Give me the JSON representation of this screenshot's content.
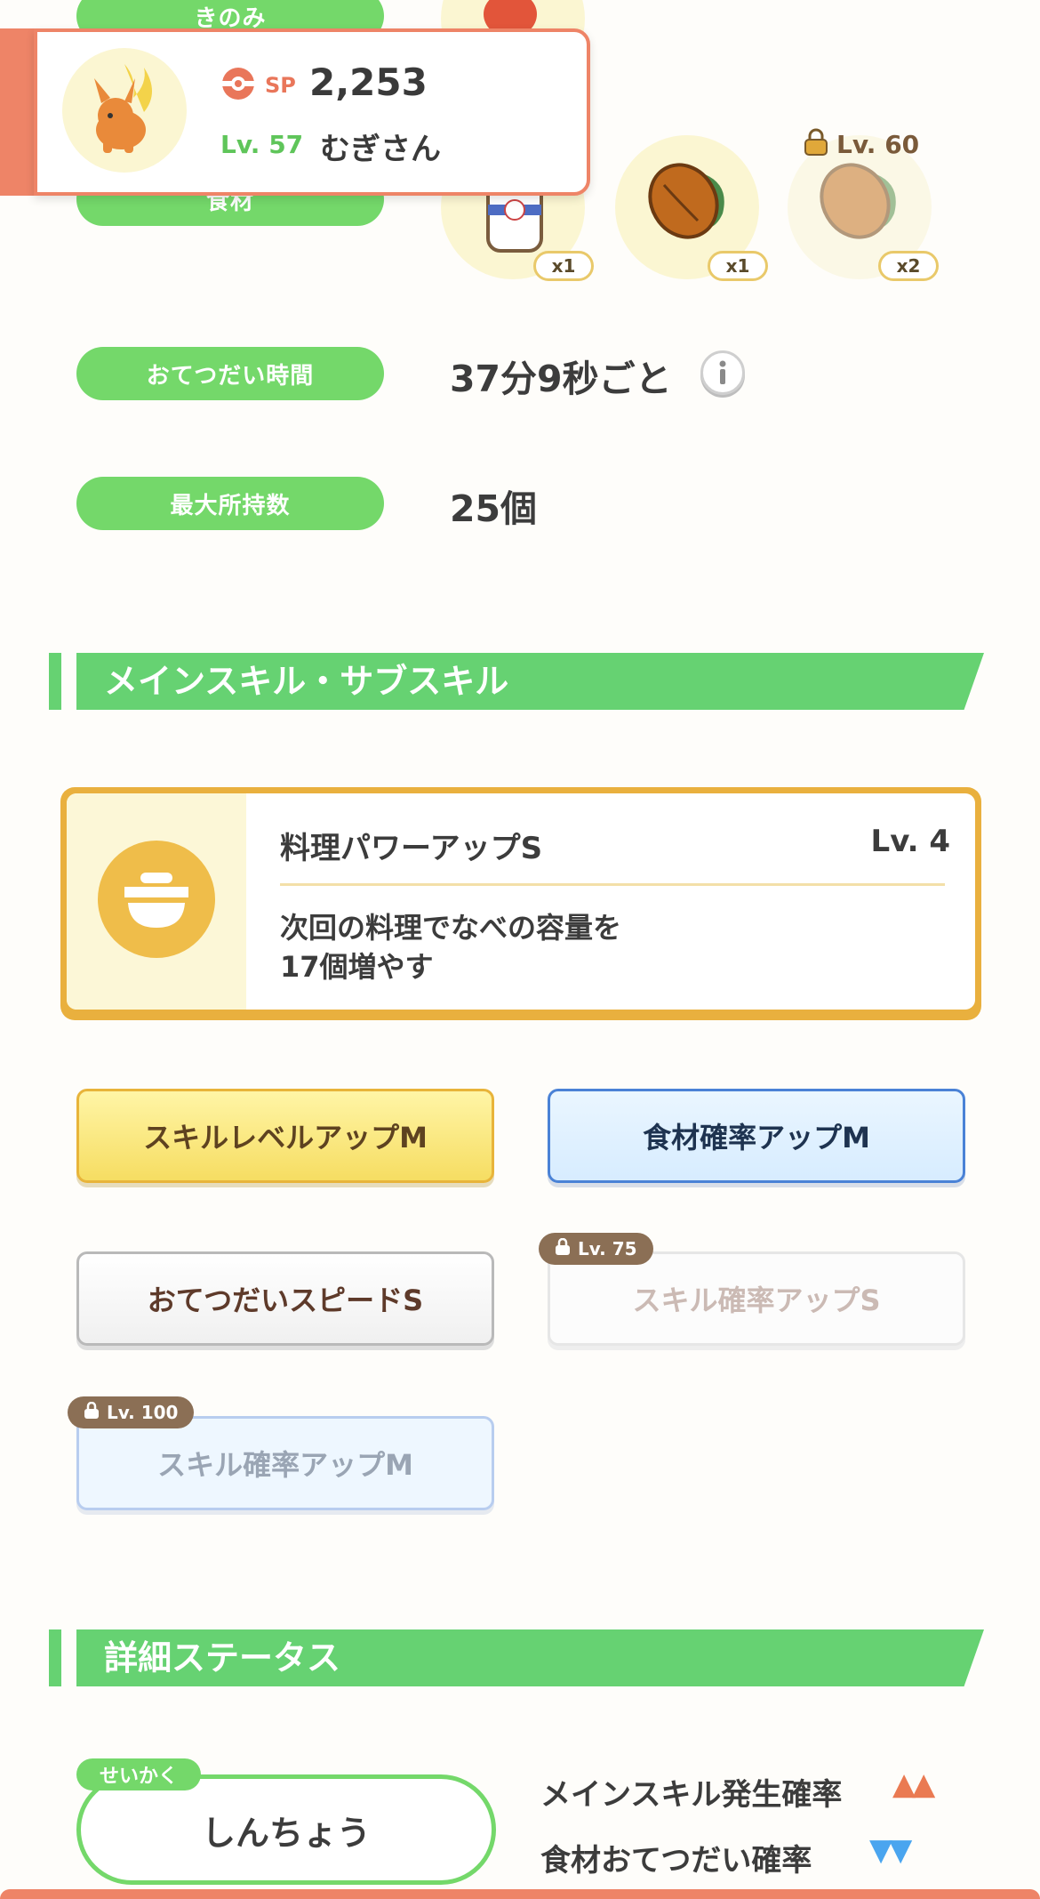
{
  "labels": {
    "berry": "きのみ",
    "ingredient": "食材",
    "help_time": "おてつだい時間",
    "max_carry": "最大所持数"
  },
  "values": {
    "help_time": "37分9秒ごと",
    "max_carry": "25個"
  },
  "ingredients": [
    {
      "name": "milk-icon",
      "qty": "x1",
      "locked": false
    },
    {
      "name": "cacao-icon",
      "qty": "x1",
      "locked": false
    },
    {
      "name": "cacao-icon",
      "qty": "x2",
      "locked": true,
      "unlock_level": "Lv. 60"
    }
  ],
  "profile": {
    "sp_label": "SP",
    "sp_value": "2,253",
    "level": "Lv. 57",
    "name": "むぎさん"
  },
  "sections": {
    "skills": "メインスキル・サブスキル",
    "details": "詳細ステータス"
  },
  "main_skill": {
    "name": "料理パワーアップS",
    "level": "Lv. 4",
    "desc_line1": "次回の料理でなべの容量を",
    "desc_line2": "17個増やす"
  },
  "subskills": [
    {
      "label": "スキルレベルアップM",
      "style": "gold",
      "locked": false
    },
    {
      "label": "食材確率アップM",
      "style": "blue",
      "locked": false
    },
    {
      "label": "おてつだいスピードS",
      "style": "white",
      "locked": false
    },
    {
      "label": "スキル確率アップS",
      "style": "white",
      "locked": true,
      "unlock_level": "Lv. 75"
    },
    {
      "label": "スキル確率アップM",
      "style": "blue",
      "locked": true,
      "unlock_level": "Lv. 100"
    }
  ],
  "nature": {
    "tag": "せいかく",
    "value": "しんちょう",
    "up_label": "メインスキル発生確率",
    "up_marks": "▲▲",
    "down_label": "食材おてつだい確率",
    "down_marks": "▼▼"
  },
  "colors": {
    "green": "#74d86a",
    "orange": "#ee8467",
    "gold": "#e9b03e",
    "up": "#ea7a52",
    "down": "#4aa5ef"
  }
}
